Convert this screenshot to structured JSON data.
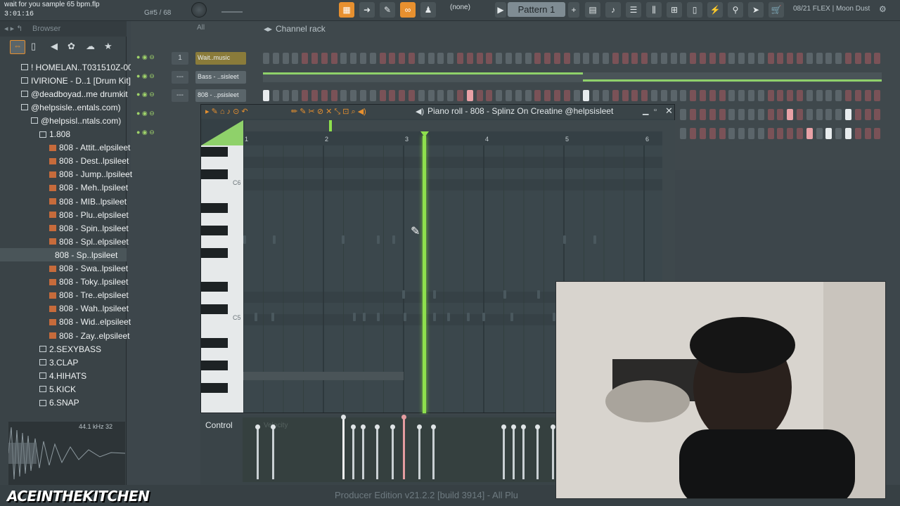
{
  "topbar": {
    "song_title": "wait for you sample 65 bpm.flp",
    "song_time": "3:01:16",
    "note_readout": "G#5 / 68",
    "none_label": "(none)",
    "pattern_label": "Pattern 1",
    "plugin_info": "08/21  FLEX | Moon Dust"
  },
  "browser": {
    "label": "Browser",
    "items": [
      {
        "label": "! HOMELAN..T031510Z-001",
        "indent": 1,
        "kind": "folder"
      },
      {
        "label": "IVIRIONE - D..1 [Drum Kit]",
        "indent": 1,
        "kind": "folder"
      },
      {
        "label": "@deadboyad..me drumkit",
        "indent": 1,
        "kind": "folder"
      },
      {
        "label": "@helpsisle..entals.com)",
        "indent": 1,
        "kind": "folder"
      },
      {
        "label": "@helpsisl..ntals.com)",
        "indent": 2,
        "kind": "folder"
      },
      {
        "label": "1.808",
        "indent": 3,
        "kind": "folder"
      },
      {
        "label": "808 - Attit..elpsileet",
        "indent": 4,
        "kind": "file"
      },
      {
        "label": "808 - Dest..lpsileet",
        "indent": 4,
        "kind": "file"
      },
      {
        "label": "808 - Jump..lpsileet",
        "indent": 4,
        "kind": "file"
      },
      {
        "label": "808 - Meh..lpsileet",
        "indent": 4,
        "kind": "file"
      },
      {
        "label": "808 - MIB..lpsileet",
        "indent": 4,
        "kind": "file"
      },
      {
        "label": "808 - Plu..elpsileet",
        "indent": 4,
        "kind": "file"
      },
      {
        "label": "808 - Spin..lpsileet",
        "indent": 4,
        "kind": "file"
      },
      {
        "label": "808 - Spl..elpsileet",
        "indent": 4,
        "kind": "file"
      },
      {
        "label": "808 - Sp..lpsileet",
        "indent": 4,
        "kind": "file",
        "selected": true
      },
      {
        "label": "808 - Swa..lpsileet",
        "indent": 4,
        "kind": "file"
      },
      {
        "label": "808 - Toky..lpsileet",
        "indent": 4,
        "kind": "file"
      },
      {
        "label": "808 - Tre..elpsileet",
        "indent": 4,
        "kind": "file"
      },
      {
        "label": "808 - Wah..lpsileet",
        "indent": 4,
        "kind": "file"
      },
      {
        "label": "808 - Wid..elpsileet",
        "indent": 4,
        "kind": "file"
      },
      {
        "label": "808 - Zay..elpsileet",
        "indent": 4,
        "kind": "file"
      },
      {
        "label": "2.SEXYBASS",
        "indent": 3,
        "kind": "folder"
      },
      {
        "label": "3.CLAP",
        "indent": 3,
        "kind": "folder"
      },
      {
        "label": "4.HIHATS",
        "indent": 3,
        "kind": "folder"
      },
      {
        "label": "5.KICK",
        "indent": 3,
        "kind": "folder"
      },
      {
        "label": "6.SNAP",
        "indent": 3,
        "kind": "folder"
      }
    ],
    "wave_info": "44.1 kHz 32"
  },
  "rack": {
    "title": "Channel rack",
    "filter": "All",
    "channels": [
      {
        "number": "1",
        "name": "Wait..music"
      },
      {
        "number": "---",
        "name": "Bass - ..sisleet"
      },
      {
        "number": "---",
        "name": "808 - ..psisleet"
      }
    ]
  },
  "piano_roll": {
    "title": "Piano roll - 808 - Splinz On Creatine @helpsisleet",
    "ruler": [
      "1",
      "2",
      "3",
      "4",
      "5",
      "6"
    ],
    "key_labels": [
      "C6",
      "C5"
    ],
    "control_label": "Control",
    "control_target": "Velocity"
  },
  "status": {
    "build_info": "Producer Edition v21.2.2 [build 3914] - All Plu",
    "overlay_handle": "ACEINTHEKITCHEN"
  },
  "colors": {
    "playhead": "#8ee04d",
    "accent_orange": "#e7902f"
  }
}
